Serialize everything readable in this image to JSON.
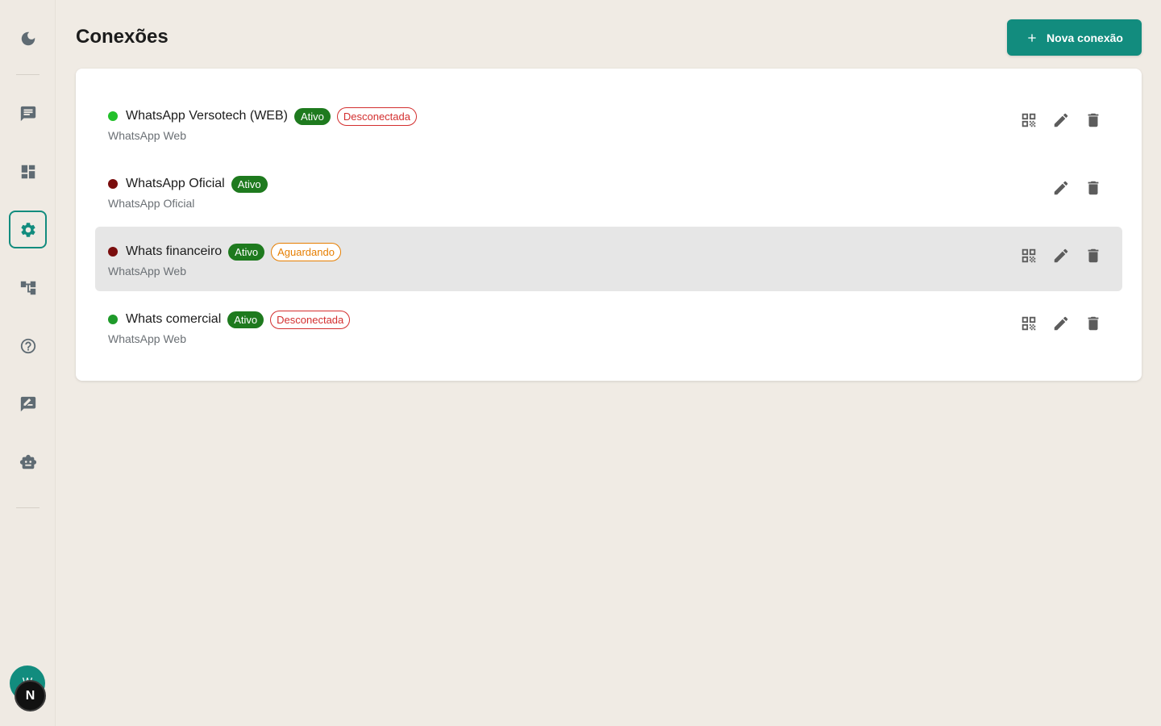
{
  "header": {
    "title": "Conexões",
    "new_button_label": "Nova conexão"
  },
  "sidebar": {
    "avatar_initials": "W",
    "user_initial": "N",
    "items": [
      {
        "icon": "moon-icon"
      },
      {
        "icon": "chat-icon"
      },
      {
        "icon": "dashboard-icon"
      },
      {
        "icon": "gear-icon",
        "active": true
      },
      {
        "icon": "hierarchy-icon"
      },
      {
        "icon": "help-icon"
      },
      {
        "icon": "rate-review-icon"
      },
      {
        "icon": "robot-icon"
      }
    ]
  },
  "colors": {
    "accent": "#128c7e",
    "active_badge": "#1e7a1e",
    "disconnected": "#d32f2f",
    "waiting": "#e67e00"
  },
  "connections": [
    {
      "name": "WhatsApp Versotech (WEB)",
      "type": "WhatsApp Web",
      "active_label": "Ativo",
      "status_label": "Desconectada",
      "dot_color": "#22c02a",
      "has_qr": true
    },
    {
      "name": "WhatsApp Oficial",
      "type": "WhatsApp Oficial",
      "active_label": "Ativo",
      "status_label": "",
      "dot_color": "#7a0d0d",
      "has_qr": false
    },
    {
      "name": "Whats financeiro",
      "type": "WhatsApp Web",
      "active_label": "Ativo",
      "status_label": "Aguardando",
      "dot_color": "#7a0d0d",
      "has_qr": true
    },
    {
      "name": "Whats comercial",
      "type": "WhatsApp Web",
      "active_label": "Ativo",
      "status_label": "Desconectada",
      "dot_color": "#1f9a2a",
      "has_qr": true
    }
  ]
}
